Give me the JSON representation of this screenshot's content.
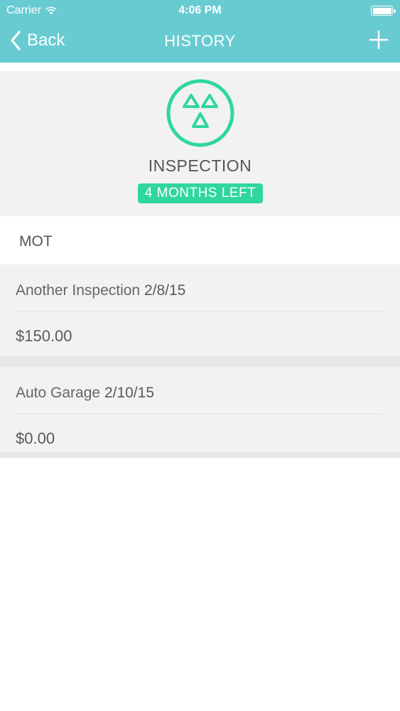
{
  "status_bar": {
    "carrier": "Carrier",
    "time": "4:06 PM"
  },
  "nav": {
    "back_label": "Back",
    "title": "HISTORY",
    "add_icon": "plus-icon"
  },
  "hero": {
    "icon": "mot-triangles-icon",
    "title": "INSPECTION",
    "badge": "4 MONTHS LEFT"
  },
  "section": {
    "label": "MOT"
  },
  "entries": [
    {
      "name": "Another Inspection",
      "date": "2/8/15",
      "amount": "$150.00"
    },
    {
      "name": "Auto Garage",
      "date": "2/10/15",
      "amount": "$0.00"
    }
  ],
  "colors": {
    "header": "#69cbd2",
    "accent": "#30d6a0",
    "card_background": "#f2f2f3"
  }
}
